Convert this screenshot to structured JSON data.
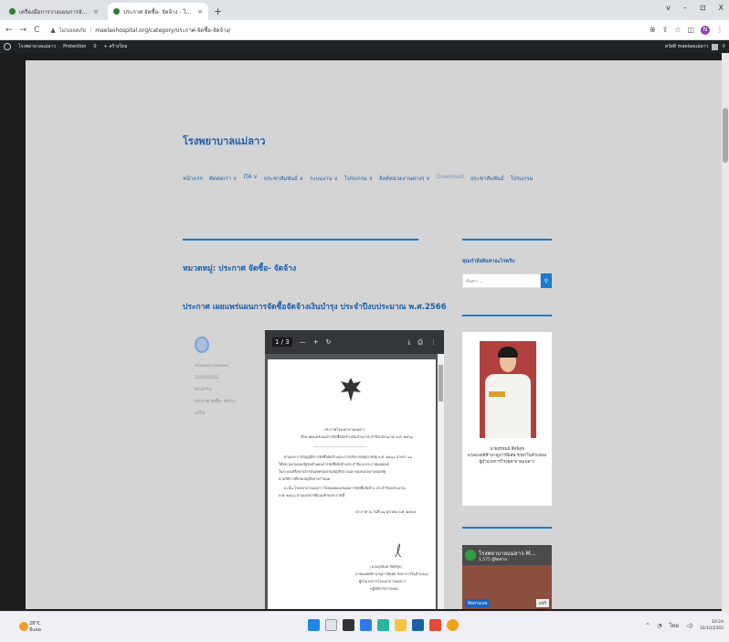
{
  "browser": {
    "tabs": [
      {
        "title": "เครื่องมือการวางแผนการจัดซื้อจัดจ้าง",
        "active": false
      },
      {
        "title": "ประกาศ จัดซื้อ- จัดจ้าง - โรงพยาบาลแม่ลาว",
        "active": true
      }
    ],
    "new_tab": "+",
    "url_warning": "ไม่ปลอดภัย",
    "url": "maelaohospital.org/category/ประกาศ-จัดซื้อ-จัดจ้าง/",
    "window_controls": [
      "v",
      "–",
      "⊡",
      "X"
    ],
    "profile_initial": "N"
  },
  "wp_admin": {
    "site": "โรงพยาบาลแม่ลาว",
    "protection": "Protection",
    "comments": "0",
    "new": "+ สร้างใหม่",
    "user": "สวัสดี maelaoแม่ลาว"
  },
  "site": {
    "title": "โรงพยาบาลแม่ลาว",
    "menu": [
      "หน้าแรก",
      "ติดต่อเรา ∨",
      "ITA ∨",
      "ประชาสัมพันธ์ ∨",
      "ระบบงาน ∨",
      "โปรแกรม ∨",
      "ลิงค์หน่วยงานต่างๆ ∨",
      "Download",
      "ประชาสัมพันธ์",
      "โปรแกรม"
    ]
  },
  "main": {
    "category_title": "หมวดหมู่: ประกาศ จัดซื้อ- จัดจ้าง",
    "post_title": "ประกาศ เผยแพร่แผนการจัดซื้อจัดจ้างเงินบำรุง ประจำปีงบประมาณ พ.ศ.2566",
    "meta": [
      "maelaoi maelaoi",
      "31/10/2022",
      "ค่าเล่ากัน",
      "ประกาศ จัดซื้อ- จัดจ้าง",
      "แก้ไข"
    ]
  },
  "pdf": {
    "page_indicator": "1 / 3",
    "zoom_out": "—",
    "zoom_in": "+",
    "lines": [
      "ประกาศโรงพยาบาลแม่ลาว",
      "เรื่อง เผยแพร่แผนการจัดซื้อจัดจ้างเงินบำรุง ประจำปีงบประมาณ พ.ศ. ๒๕๖๖",
      "-------------------------------------------",
      "ตามพระราชบัญญัติการจัดซื้อจัดจ้างและการบริหารพัสดุภาครัฐ พ.ศ. ๒๕๖๐ มาตรา ๑๑",
      "ให้หน่วยงานของรัฐจัดทำแผนการจัดซื้อจัดจ้างประจำปีและประกาศเผยแพร่",
      "ในระบบเครือข่ายสารสนเทศของกรมบัญชีกลางและของหน่วยงานของรัฐ",
      "ตามวิธีการที่กรมบัญชีกลางกำหนด",
      "ฉะนั้น โรงพยาบาลแม่ลาว จึงขอเผยแพร่แผนการจัดซื้อจัดจ้าง ประจำปีงบประมาณ",
      "พ.ศ. ๒๕๖๖ ตามเอกสารที่แนบท้ายประกาศนี้",
      "ประกาศ ณ วันที่ ๓๑ ตุลาคม พ.ศ. ๒๕๖๕",
      "(นายสุรพันธ์ สิทธิสุข)",
      "นายแพทย์ชำนาญการพิเศษ รักษาการในตำแหน่ง",
      "ผู้อำนวยการโรงพยาบาลแม่ลาว",
      "ปฏิบัติราชการแทน"
    ]
  },
  "sidebar": {
    "search_label": "คุณกำลังค้นหาอะไรครับ",
    "search_placeholder": "ค้นหา ...",
    "search_icon": "⚲",
    "person_name": "นายสุรพันธ์ สิทธิสุข",
    "person_role": "นายแพทย์ชำนาญการพิเศษ รักษาในตำแหน่ง",
    "person_role2": "ผู้อำนวยการโรงพยาบาลแม่ลาว",
    "fb_name": "โรงพยาบาลแม่ลาว-M...",
    "fb_likes": "1,575 ผู้ติดตาม",
    "fb_follow": "ติดตามเพจ",
    "fb_share": "แชร์"
  },
  "taskbar": {
    "temp": "28°C",
    "weather": "มีแดด",
    "lang": "ไทย",
    "time": "10:24",
    "date": "31/10/2565"
  }
}
